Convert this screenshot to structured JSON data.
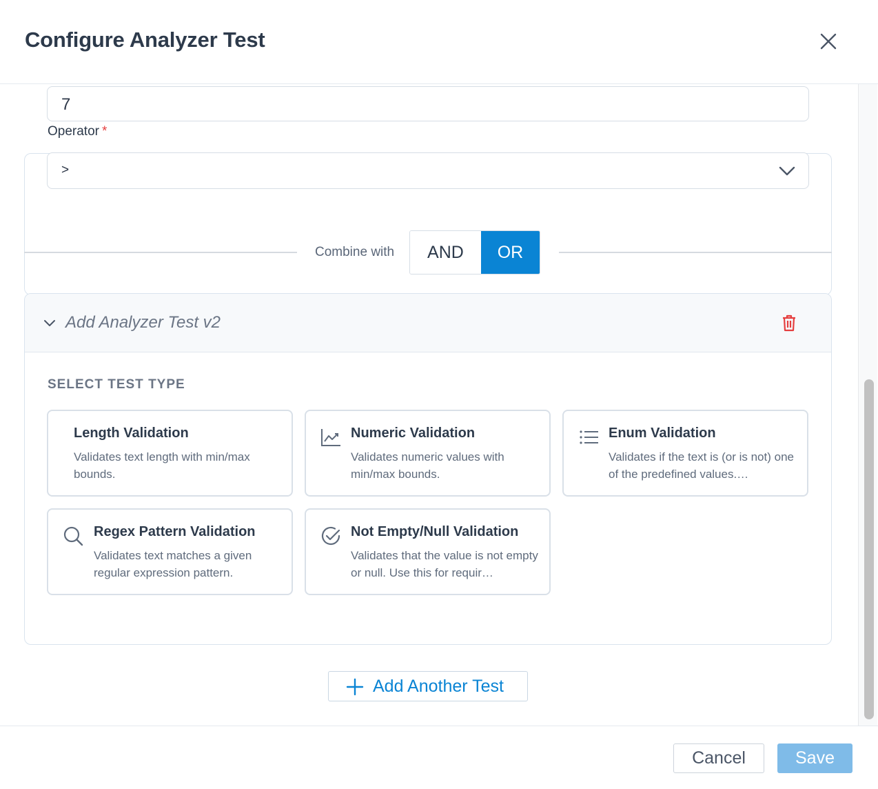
{
  "modal": {
    "title": "Configure Analyzer Test"
  },
  "condition": {
    "value": "7",
    "operator_label": "Operator",
    "operator_required": "*",
    "operator_value": ">"
  },
  "combine": {
    "label": "Combine with",
    "options": [
      "AND",
      "OR"
    ],
    "selected": "OR"
  },
  "analyzer_test": {
    "title": "Add Analyzer Test v2",
    "section_label": "SELECT TEST TYPE",
    "test_types": [
      {
        "title": "Length Validation",
        "description": "Validates text length with min/max bounds.",
        "icon": "none"
      },
      {
        "title": "Numeric Validation",
        "description": "Validates numeric values with min/max bounds.",
        "icon": "chart-line-icon"
      },
      {
        "title": "Enum Validation",
        "description": "Validates if the text is (or is not) one of the predefined values.…",
        "icon": "list-icon"
      },
      {
        "title": "Regex Pattern Validation",
        "description": "Validates text matches a given regular expression pattern.",
        "icon": "search-icon"
      },
      {
        "title": "Not Empty/Null Validation",
        "description": "Validates that the value is not empty or null. Use this for requir…",
        "icon": "check-circle-icon"
      }
    ]
  },
  "add_test_button": {
    "label": "Add Another Test"
  },
  "footer": {
    "cancel_label": "Cancel",
    "save_label": "Save"
  },
  "colors": {
    "accent": "#0a84d4",
    "save_disabled": "#7fbbe8",
    "danger": "#e53e3e"
  }
}
